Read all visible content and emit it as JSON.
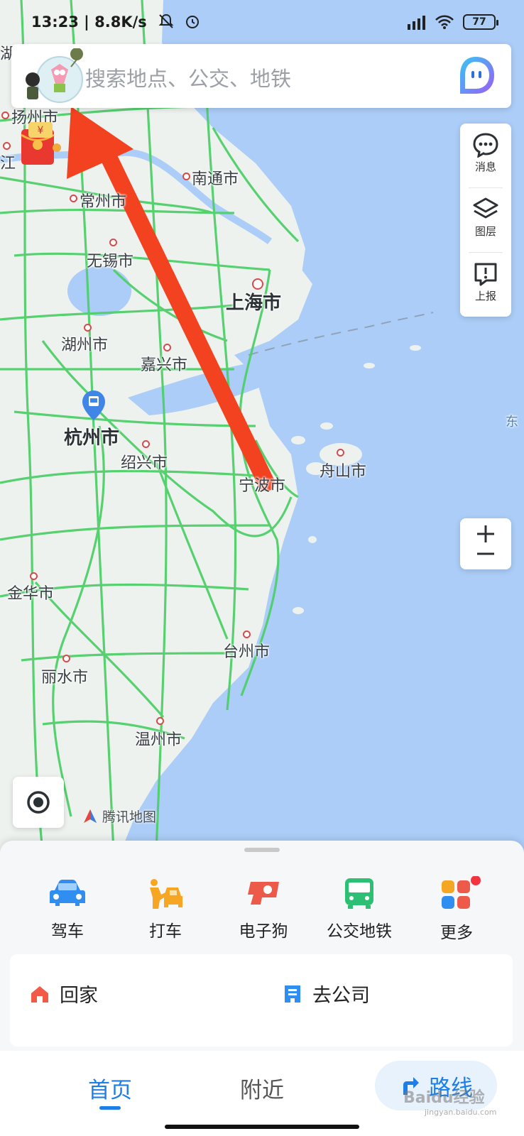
{
  "status_bar": {
    "time": "13:23",
    "network_speed": "8.8K/s",
    "battery": "77"
  },
  "search": {
    "placeholder": "搜索地点、公交、地铁"
  },
  "map": {
    "cities": [
      "扬州市",
      "江",
      "南通市",
      "常州市",
      "无锡市",
      "上海市",
      "湖州市",
      "嘉兴市",
      "杭州市",
      "绍兴市",
      "宁波市",
      "舟山市",
      "金华市",
      "台州市",
      "丽水市",
      "温州市",
      "湖",
      "东"
    ],
    "brand": "腾讯地图",
    "annotation": "red arrow pointing to profile avatar"
  },
  "right_tools": {
    "messages": "消息",
    "layers": "图层",
    "report": "上报"
  },
  "quick_actions": {
    "drive": "驾车",
    "taxi": "打车",
    "camera": "电子狗",
    "transit": "公交地铁",
    "more": "更多"
  },
  "places": {
    "home": "回家",
    "company": "去公司"
  },
  "bottom_nav": {
    "home": "首页",
    "nearby": "附近",
    "route": "路线"
  },
  "watermark": {
    "main": "Baidu经验",
    "sub": "jingyan.baidu.com"
  },
  "colors": {
    "accent": "#1e7ee8",
    "road": "#4fcf6a",
    "sea": "#abcdf7",
    "arrow": "#f2421f"
  }
}
